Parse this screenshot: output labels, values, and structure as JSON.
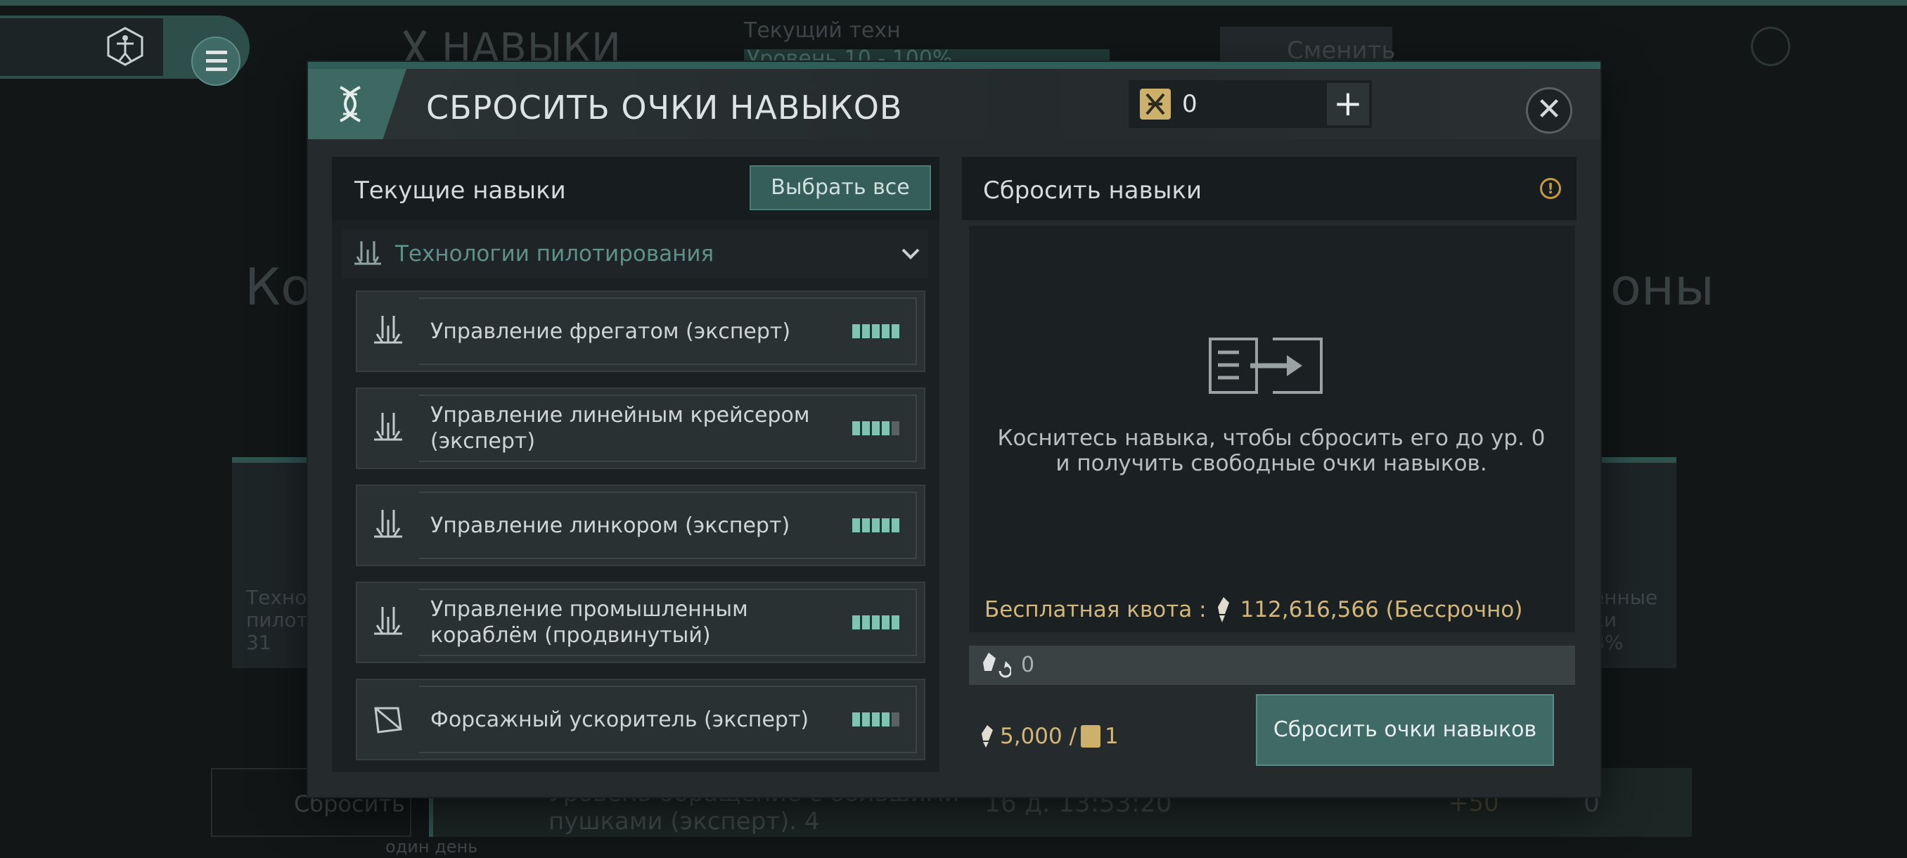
{
  "background": {
    "section_title": "НАВЫКИ",
    "tech_label": "Текущий техн",
    "tech_value": "Уровень 10 - 100%",
    "change_label": "Сменить",
    "big_left_text": "Ко",
    "big_right_text": "оны",
    "card_left_text": "Техно\nпилоти\n31",
    "card_right_text": "енные\nки\n3%",
    "reset_label": "Сбросить",
    "reset_sub": "один день",
    "queue_text": "Уровень обращение с большими\nпушками (эксперт). 4",
    "queue_time": "16 д. 13:53:20",
    "queue_bonus": "+50",
    "queue_zero": "0"
  },
  "modal": {
    "title": "СБРОСИТЬ ОЧКИ НАВЫКОВ",
    "currency_value": "0",
    "plus_label": "+",
    "close_label": "✕"
  },
  "current_skills": {
    "title": "Текущие навыки",
    "select_all_label": "Выбрать все",
    "group_title": "Технологии пилотирования",
    "items": [
      {
        "name": "Управление фрегатом (эксперт)",
        "level": 5,
        "max": 5
      },
      {
        "name": "Управление линейным крейсером (эксперт)",
        "level": 4,
        "max": 5
      },
      {
        "name": "Управление линкором (эксперт)",
        "level": 5,
        "max": 5
      },
      {
        "name": "Управление промышленным кораблём (продвинутый)",
        "level": 5,
        "max": 5
      },
      {
        "name": "Форсажный ускоритель (эксперт)",
        "level": 4,
        "max": 5
      }
    ]
  },
  "reset_panel": {
    "title": "Сбросить навыки",
    "warning_icon": "!",
    "hint": "Коснитесь навыка, чтобы сбросить его до ур. 0 и получить свободные очки навыков.",
    "quota_label": "Бесплатная квота :",
    "quota_value": "112,616,566 (Бессрочно)",
    "selected_value": "0",
    "cost_points": "5,000 /",
    "cost_currency": "1",
    "reset_button_label": "Сбросить очки навыков"
  },
  "colors": {
    "accent": "#3f6a65",
    "gold": "#d1b77a",
    "level_on": "#7fc3b3",
    "level_off": "#5a6163"
  }
}
